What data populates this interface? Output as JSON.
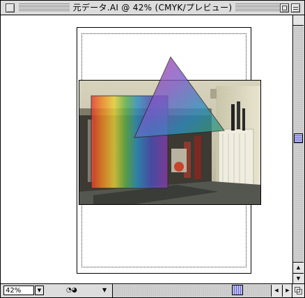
{
  "window": {
    "title": "元データ.AI @ 42% (CMYK/プレビュー)"
  },
  "statusbar": {
    "zoom_value": "42%",
    "zoom_popup_icon": "chevron-down-icon",
    "status_icons": "◔◕",
    "status_menu_icon": "triangle-down-icon"
  },
  "scrollbars": {
    "up_arrow": "▲",
    "down_arrow": "▼",
    "left_arrow": "◀",
    "right_arrow": "▶"
  },
  "colors": {
    "selection_thumb": "#b8b8f0",
    "window_chrome": "#dddddd"
  }
}
